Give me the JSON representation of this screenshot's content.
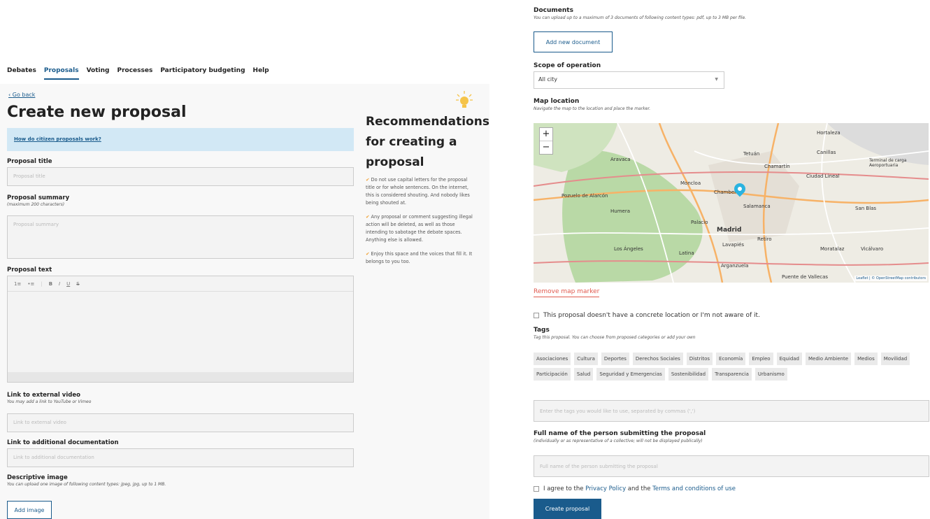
{
  "nav": {
    "items": [
      "Debates",
      "Proposals",
      "Voting",
      "Processes",
      "Participatory budgeting",
      "Help"
    ],
    "active": "Proposals"
  },
  "left": {
    "go_back": "Go back",
    "title": "Create new proposal",
    "help_link": "How do citizen proposals work?",
    "proposal_title_label": "Proposal title",
    "proposal_title_placeholder": "Proposal title",
    "summary_label": "Proposal summary",
    "summary_hint": "(maximum 200 characters)",
    "summary_placeholder": "Proposal summary",
    "text_label": "Proposal text",
    "toolbar_icons": [
      "ordered-list-icon",
      "bullet-list-icon",
      "bold-icon",
      "italic-icon",
      "underline-icon",
      "strikethrough-icon"
    ],
    "video_label": "Link to external video",
    "video_hint": "You may add a link to YouTube or Vimeo",
    "video_placeholder": "Link to external video",
    "docs_label": "Link to additional documentation",
    "docs_placeholder": "Link to additional documentation",
    "image_label": "Descriptive image",
    "image_hint": "You can upload one image of following content types: jpeg, jpg, up to 1 MB.",
    "add_image": "Add image"
  },
  "recommendations": {
    "title": "Recommendations for creating a proposal",
    "items": [
      "Do not use capital letters for the proposal title or for whole sentences. On the internet, this is considered shouting. And nobody likes being shouted at.",
      "Any proposal or comment suggesting illegal action will be deleted, as well as those intending to sabotage the debate spaces. Anything else is allowed.",
      "Enjoy this space and the voices that fill it. It belongs to you too."
    ]
  },
  "right": {
    "documents_label": "Documents",
    "documents_hint": "You can upload up to a maximum of 3 documents of following content types: pdf, up to 3 MB per file.",
    "add_document": "Add new document",
    "scope_label": "Scope of operation",
    "scope_value": "All city",
    "map_label": "Map location",
    "map_hint": "Navigate the map to the location and place the marker.",
    "map_labels": [
      "Pozuelo de Alarcón",
      "Madrid",
      "Hortaleza",
      "Tetuán",
      "Chamartín",
      "Canillas",
      "Ciudad Lineal",
      "Aravaca",
      "Moncloa",
      "Salamanca",
      "Retiro",
      "Latina",
      "Los Ángeles",
      "Puente de Vallecas",
      "Moratalaz",
      "Vicálvaro",
      "Chamberí",
      "Arganzuela",
      "Lavapiés",
      "Humera",
      "Palacio",
      "Terminal de carga Aeroportuaria",
      "San Blas"
    ],
    "attribution": "Leaflet | © OpenStreetMap contributors",
    "remove_marker": "Remove map marker",
    "no_location": "This proposal doesn't have a concrete location or I'm not aware of it.",
    "tags_label": "Tags",
    "tags_hint": "Tag this proposal. You can choose from proposed categories or add your own",
    "tags": [
      "Asociaciones",
      "Cultura",
      "Deportes",
      "Derechos Sociales",
      "Distritos",
      "Economía",
      "Empleo",
      "Equidad",
      "Medio Ambiente",
      "Medios",
      "Movilidad",
      "Participación",
      "Salud",
      "Seguridad y Emergencias",
      "Sostenibilidad",
      "Transparencia",
      "Urbanismo"
    ],
    "tags_placeholder": "Enter the tags you would like to use, separated by commas (',')",
    "fullname_label": "Full name of the person submitting the proposal",
    "fullname_hint": "(individually or as representative of a collective; will not be displayed publically)",
    "fullname_placeholder": "Full name of the person submitting the proposal",
    "agree_prefix": "I agree to the ",
    "privacy": "Privacy Policy",
    "and": " and the ",
    "terms": "Terms and conditions of use",
    "submit": "Create proposal"
  },
  "colors": {
    "brand": "#1a5b8c",
    "help_bg": "#d2e8f5",
    "marker": "#2ab3e0",
    "remove": "#e05a4f"
  }
}
